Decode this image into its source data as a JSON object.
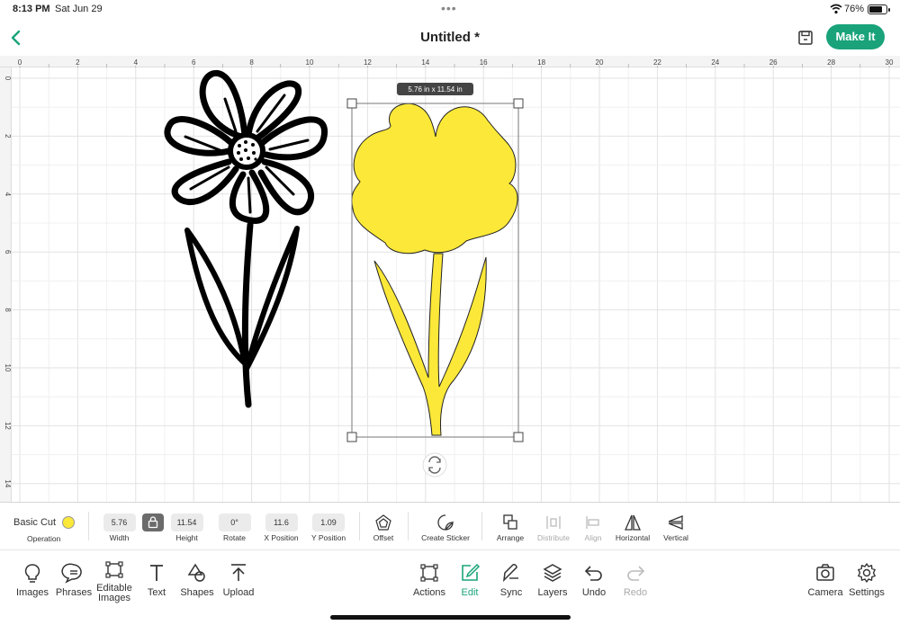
{
  "status_bar": {
    "time": "8:13 PM",
    "date": "Sat Jun 29",
    "battery": "76%",
    "battery_level": 0.76
  },
  "header": {
    "title": "Untitled  *",
    "make_it_label": "Make It"
  },
  "rulers": {
    "top": [
      "0",
      "2",
      "4",
      "6",
      "8",
      "10",
      "12",
      "14",
      "16",
      "18",
      "20",
      "22",
      "24",
      "26",
      "28",
      "30"
    ],
    "left": [
      "0",
      "2",
      "4",
      "6",
      "8",
      "10",
      "12",
      "14"
    ]
  },
  "selection": {
    "dimensions_tooltip": "5.76 in x 11.54 in"
  },
  "edit_bar": {
    "operation_value": "Basic Cut",
    "operation_label": "Operation",
    "operation_color": "#fbe838",
    "width_value": "5.76",
    "width_label": "Width",
    "height_value": "11.54",
    "height_label": "Height",
    "rotate_value": "0°",
    "rotate_label": "Rotate",
    "x_value": "11.6",
    "x_label": "X Position",
    "y_value": "1.09",
    "y_label": "Y Position",
    "offset_label": "Offset",
    "sticker_label": "Create Sticker",
    "arrange_label": "Arrange",
    "distribute_label": "Distribute",
    "align_label": "Align",
    "horizontal_label": "Horizontal",
    "vertical_label": "Vertical"
  },
  "main_bar": {
    "images": "Images",
    "phrases": "Phrases",
    "editable_images": "Editable Images",
    "text": "Text",
    "shapes": "Shapes",
    "upload": "Upload",
    "actions": "Actions",
    "edit": "Edit",
    "sync": "Sync",
    "layers": "Layers",
    "undo": "Undo",
    "redo": "Redo",
    "camera": "Camera",
    "settings": "Settings"
  },
  "colors": {
    "accent": "#1aa37a",
    "fill_yellow": "#fbe838"
  }
}
